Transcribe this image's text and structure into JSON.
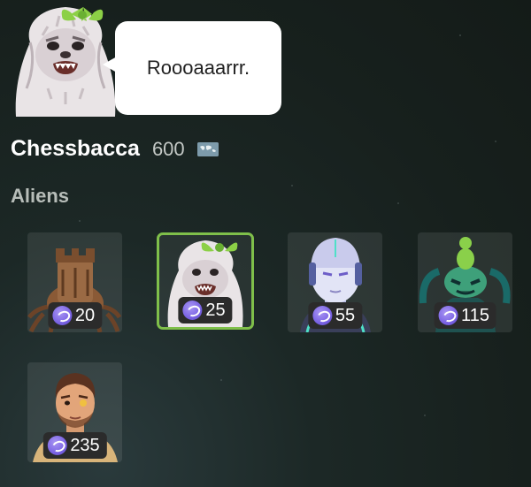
{
  "speech": "Roooaaarrr.",
  "player": {
    "name": "Chessbacca",
    "rating": "600",
    "flag_icon": "world-map-flag-icon"
  },
  "section": {
    "title": "Aliens"
  },
  "colors": {
    "coin": "#7a63e4",
    "selected_border": "#7fbf4a"
  },
  "aliens": [
    {
      "name": "rook-bug",
      "price": "20"
    },
    {
      "name": "chessbacca",
      "price": "25",
      "selected": true
    },
    {
      "name": "robot",
      "price": "55"
    },
    {
      "name": "green-alien",
      "price": "115"
    },
    {
      "name": "human-pilot",
      "price": "235"
    }
  ]
}
